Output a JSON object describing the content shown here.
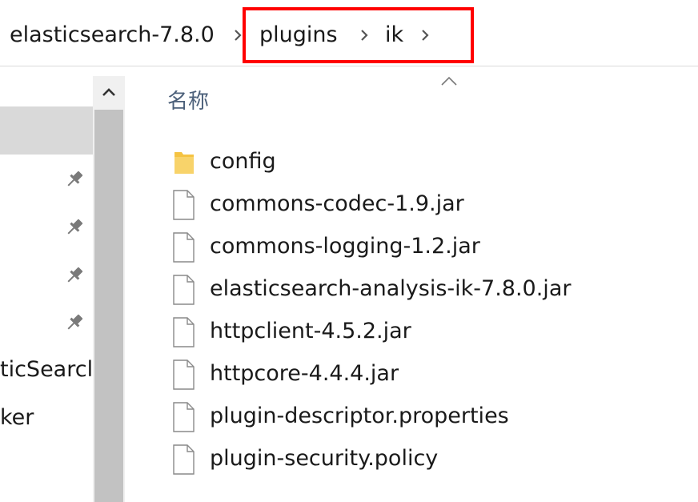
{
  "breadcrumb": {
    "items": [
      "elasticsearch-7.8.0",
      "plugins",
      "ik"
    ],
    "separator_icon": "chevron-right-icon"
  },
  "nav": {
    "partial_labels": [
      "ticSearcl",
      "ker"
    ],
    "pin_icon": "pin-icon"
  },
  "content": {
    "column_header": "名称",
    "sort_icon": "sort-ascending-icon",
    "files": [
      {
        "name": "config",
        "type": "folder"
      },
      {
        "name": "commons-codec-1.9.jar",
        "type": "file"
      },
      {
        "name": "commons-logging-1.2.jar",
        "type": "file"
      },
      {
        "name": "elasticsearch-analysis-ik-7.8.0.jar",
        "type": "file"
      },
      {
        "name": "httpclient-4.5.2.jar",
        "type": "file"
      },
      {
        "name": "httpcore-4.4.4.jar",
        "type": "file"
      },
      {
        "name": "plugin-descriptor.properties",
        "type": "file"
      },
      {
        "name": "plugin-security.policy",
        "type": "file"
      }
    ]
  },
  "colors": {
    "highlight": "#ff0000",
    "selected_nav": "#d9d9d9",
    "folder": "#f5c342",
    "header_text": "#4c607a"
  }
}
